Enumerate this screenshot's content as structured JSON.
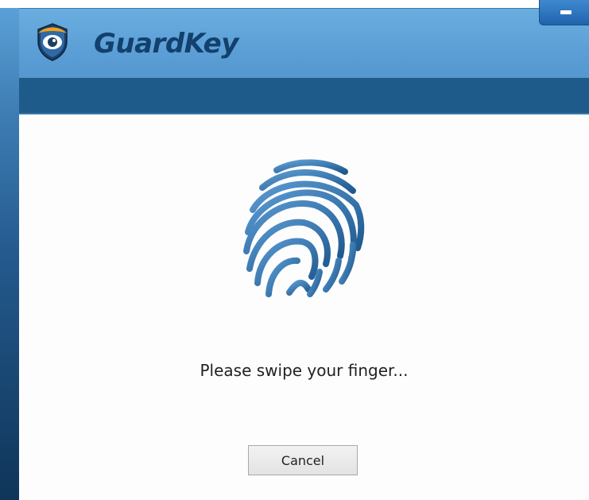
{
  "window": {
    "app_title": "GuardKey",
    "minimize_icon": "minimize-icon"
  },
  "logo": {
    "icon": "shield-eye-logo"
  },
  "main": {
    "fingerprint_icon": "fingerprint-icon",
    "prompt": "Please swipe your finger...",
    "cancel_label": "Cancel"
  },
  "colors": {
    "title_bar": "#5b9fd6",
    "subheader": "#1f5b8a",
    "title_text": "#13406d",
    "fingerprint": "#3a78b0"
  }
}
